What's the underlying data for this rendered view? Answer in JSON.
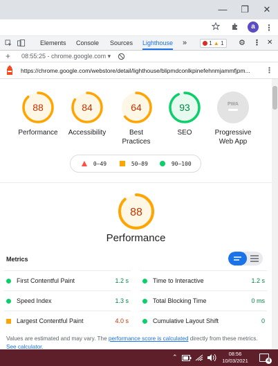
{
  "window": {
    "minimize": "—",
    "restore": "❐",
    "close": "✕"
  },
  "toolbar": {
    "star_icon": "star-icon",
    "extensions_icon": "puzzle-icon",
    "avatar_letter": "a",
    "menu": "⋮"
  },
  "devtools": {
    "tabs": [
      {
        "label": "Elements"
      },
      {
        "label": "Console"
      },
      {
        "label": "Sources"
      },
      {
        "label": "Lighthouse"
      }
    ],
    "more": "»",
    "errors": "1",
    "warnings": "1",
    "settings": "⚙",
    "menu": "⋮",
    "close": "✕"
  },
  "report_bar": {
    "add": "+",
    "report": "08:55:25 - chrome.google.com ▾",
    "clear": "⃠"
  },
  "url_bar": {
    "url": "https://chrome.google.com/webstore/detail/lighthouse/blipmdconlkpinefehnmjammfjpm...",
    "menu": "⋮"
  },
  "colors": {
    "average": "#ffa400",
    "pass": "#0cce6b",
    "fail": "#ff4e42",
    "link": "#1a73e8"
  },
  "scores": [
    {
      "value": "88",
      "label": "Performance",
      "score": 88,
      "status": "average"
    },
    {
      "value": "84",
      "label": "Accessibility",
      "score": 84,
      "status": "average"
    },
    {
      "value": "64",
      "label": "Best Practices",
      "score": 64,
      "status": "average"
    },
    {
      "value": "93",
      "label": "SEO",
      "score": 93,
      "status": "pass"
    },
    {
      "value": "PWA",
      "label": "Progressive Web App",
      "score": null,
      "status": "na"
    }
  ],
  "legend": [
    {
      "range": "0–49",
      "shape": "triangle",
      "status": "fail"
    },
    {
      "range": "50–89",
      "shape": "square",
      "status": "average"
    },
    {
      "range": "90–100",
      "shape": "circle",
      "status": "pass"
    }
  ],
  "performance": {
    "score": "88",
    "score_value": 88,
    "title": "Performance"
  },
  "metrics": {
    "title": "Metrics",
    "items": [
      {
        "label": "First Contentful Paint",
        "value": "1.2 s",
        "status": "pass"
      },
      {
        "label": "Time to Interactive",
        "value": "1.2 s",
        "status": "pass"
      },
      {
        "label": "Speed Index",
        "value": "1.3 s",
        "status": "pass"
      },
      {
        "label": "Total Blocking Time",
        "value": "0 ms",
        "status": "pass"
      },
      {
        "label": "Largest Contentful Paint",
        "value": "4.0 s",
        "status": "average"
      },
      {
        "label": "Cumulative Layout Shift",
        "value": "0",
        "status": "pass"
      }
    ]
  },
  "note": {
    "prefix": "Values are estimated and may vary. The ",
    "link1": "performance score is calculated",
    "middle": " directly from these metrics. ",
    "link2": "See calculator."
  },
  "taskbar": {
    "time": "08:56",
    "date": "10/03/2021",
    "notifications": "4"
  }
}
